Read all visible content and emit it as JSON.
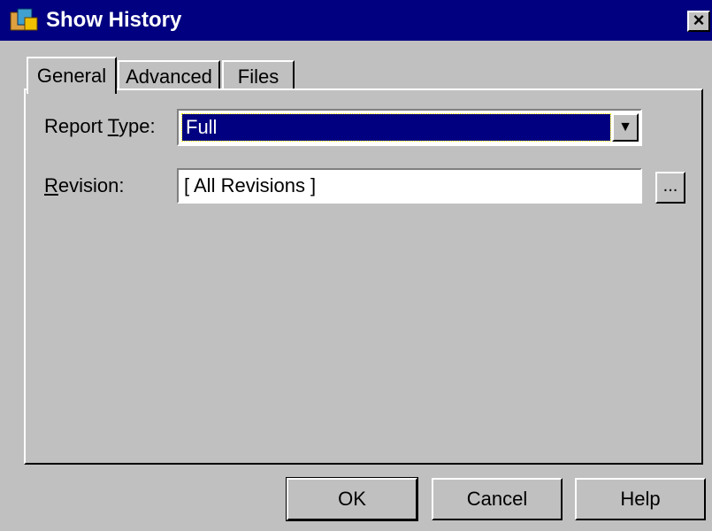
{
  "window": {
    "title": "Show History",
    "close_label": "×"
  },
  "tabs": [
    {
      "label": "General",
      "active": true
    },
    {
      "label": "Advanced",
      "active": false
    },
    {
      "label": "Files",
      "active": false
    }
  ],
  "form": {
    "report_type_label_pre": "Report ",
    "report_type_label_key": "T",
    "report_type_label_post": "ype:",
    "report_type_value": "Full",
    "revision_label_key": "R",
    "revision_label_post": "evision:",
    "revision_value": "[ All Revisions ]",
    "browse_label": "..."
  },
  "buttons": {
    "ok": "OK",
    "cancel": "Cancel",
    "help": "Help"
  },
  "icons": {
    "dropdown": "▼"
  },
  "colors": {
    "titlebar": "#000080",
    "dialog_bg": "#c0c0c0",
    "selection": "#000080"
  }
}
